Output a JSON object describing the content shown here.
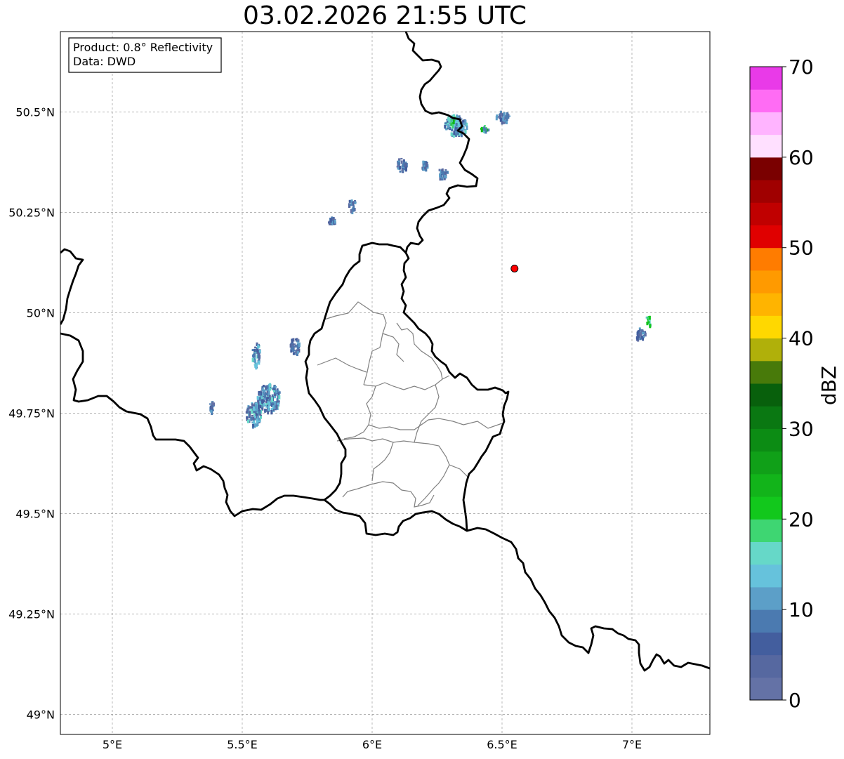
{
  "title": "03.02.2026 21:55 UTC",
  "info_box": {
    "product": "Product: 0.8° Reflectivity",
    "data": "Data: DWD"
  },
  "axes": {
    "x_ticks": [
      {
        "value": 5.0,
        "label": "5°E"
      },
      {
        "value": 5.5,
        "label": "5.5°E"
      },
      {
        "value": 6.0,
        "label": "6°E"
      },
      {
        "value": 6.5,
        "label": "6.5°E"
      },
      {
        "value": 7.0,
        "label": "7°E"
      }
    ],
    "y_ticks": [
      {
        "value": 49.0,
        "label": "49°N"
      },
      {
        "value": 49.25,
        "label": "49.25°N"
      },
      {
        "value": 49.5,
        "label": "49.5°N"
      },
      {
        "value": 49.75,
        "label": "49.75°N"
      },
      {
        "value": 50.0,
        "label": "50°N"
      },
      {
        "value": 50.25,
        "label": "50.25°N"
      },
      {
        "value": 50.5,
        "label": "50.5°N"
      }
    ],
    "lon_range": [
      4.8,
      7.3
    ],
    "lat_range": [
      48.95,
      50.7
    ],
    "grid": true
  },
  "radar_site": {
    "lon": 6.548,
    "lat": 50.11,
    "color": "#ff0000"
  },
  "colorbar": {
    "label": "dBZ",
    "min": 0,
    "max": 70,
    "step": 2.5,
    "tick_labels": [
      "0",
      "10",
      "20",
      "30",
      "40",
      "50",
      "60",
      "70"
    ],
    "colors": [
      "#6472a6",
      "#5668a0",
      "#435e9e",
      "#4b7ab0",
      "#5c9fc8",
      "#66c2dc",
      "#66d8c8",
      "#3ed672",
      "#12c81c",
      "#12b41a",
      "#10a018",
      "#0c8c14",
      "#0a7812",
      "#08600c",
      "#487a0a",
      "#b0b00a",
      "#ffd800",
      "#ffb400",
      "#ff9a00",
      "#ff7c00",
      "#e00000",
      "#c00000",
      "#a00000",
      "#7a0000",
      "#ffe0ff",
      "#ffb4ff",
      "#ff6cf4",
      "#e93ae8"
    ]
  },
  "precip_cells": [
    {
      "lon": 6.32,
      "lat": 50.47,
      "w": 0.09,
      "h": 0.05,
      "level": "medium"
    },
    {
      "lon": 6.31,
      "lat": 50.48,
      "w": 0.04,
      "h": 0.02,
      "level": "high"
    },
    {
      "lon": 6.5,
      "lat": 50.49,
      "w": 0.05,
      "h": 0.03,
      "level": "low"
    },
    {
      "lon": 6.43,
      "lat": 50.46,
      "w": 0.03,
      "h": 0.015,
      "level": "high"
    },
    {
      "lon": 6.11,
      "lat": 50.37,
      "w": 0.04,
      "h": 0.035,
      "level": "low"
    },
    {
      "lon": 6.2,
      "lat": 50.37,
      "w": 0.025,
      "h": 0.025,
      "level": "low"
    },
    {
      "lon": 6.27,
      "lat": 50.35,
      "w": 0.035,
      "h": 0.03,
      "level": "low"
    },
    {
      "lon": 5.92,
      "lat": 50.27,
      "w": 0.03,
      "h": 0.03,
      "level": "low"
    },
    {
      "lon": 5.84,
      "lat": 50.23,
      "w": 0.03,
      "h": 0.02,
      "level": "low"
    },
    {
      "lon": 7.06,
      "lat": 49.98,
      "w": 0.02,
      "h": 0.03,
      "level": "high"
    },
    {
      "lon": 7.03,
      "lat": 49.95,
      "w": 0.04,
      "h": 0.03,
      "level": "low"
    },
    {
      "lon": 5.6,
      "lat": 49.79,
      "w": 0.09,
      "h": 0.07,
      "level": "medium"
    },
    {
      "lon": 5.54,
      "lat": 49.75,
      "w": 0.06,
      "h": 0.06,
      "level": "medium"
    },
    {
      "lon": 5.55,
      "lat": 49.9,
      "w": 0.03,
      "h": 0.06,
      "level": "medium"
    },
    {
      "lon": 5.7,
      "lat": 49.92,
      "w": 0.04,
      "h": 0.04,
      "level": "low"
    },
    {
      "lon": 5.38,
      "lat": 49.77,
      "w": 0.015,
      "h": 0.03,
      "level": "low"
    }
  ]
}
